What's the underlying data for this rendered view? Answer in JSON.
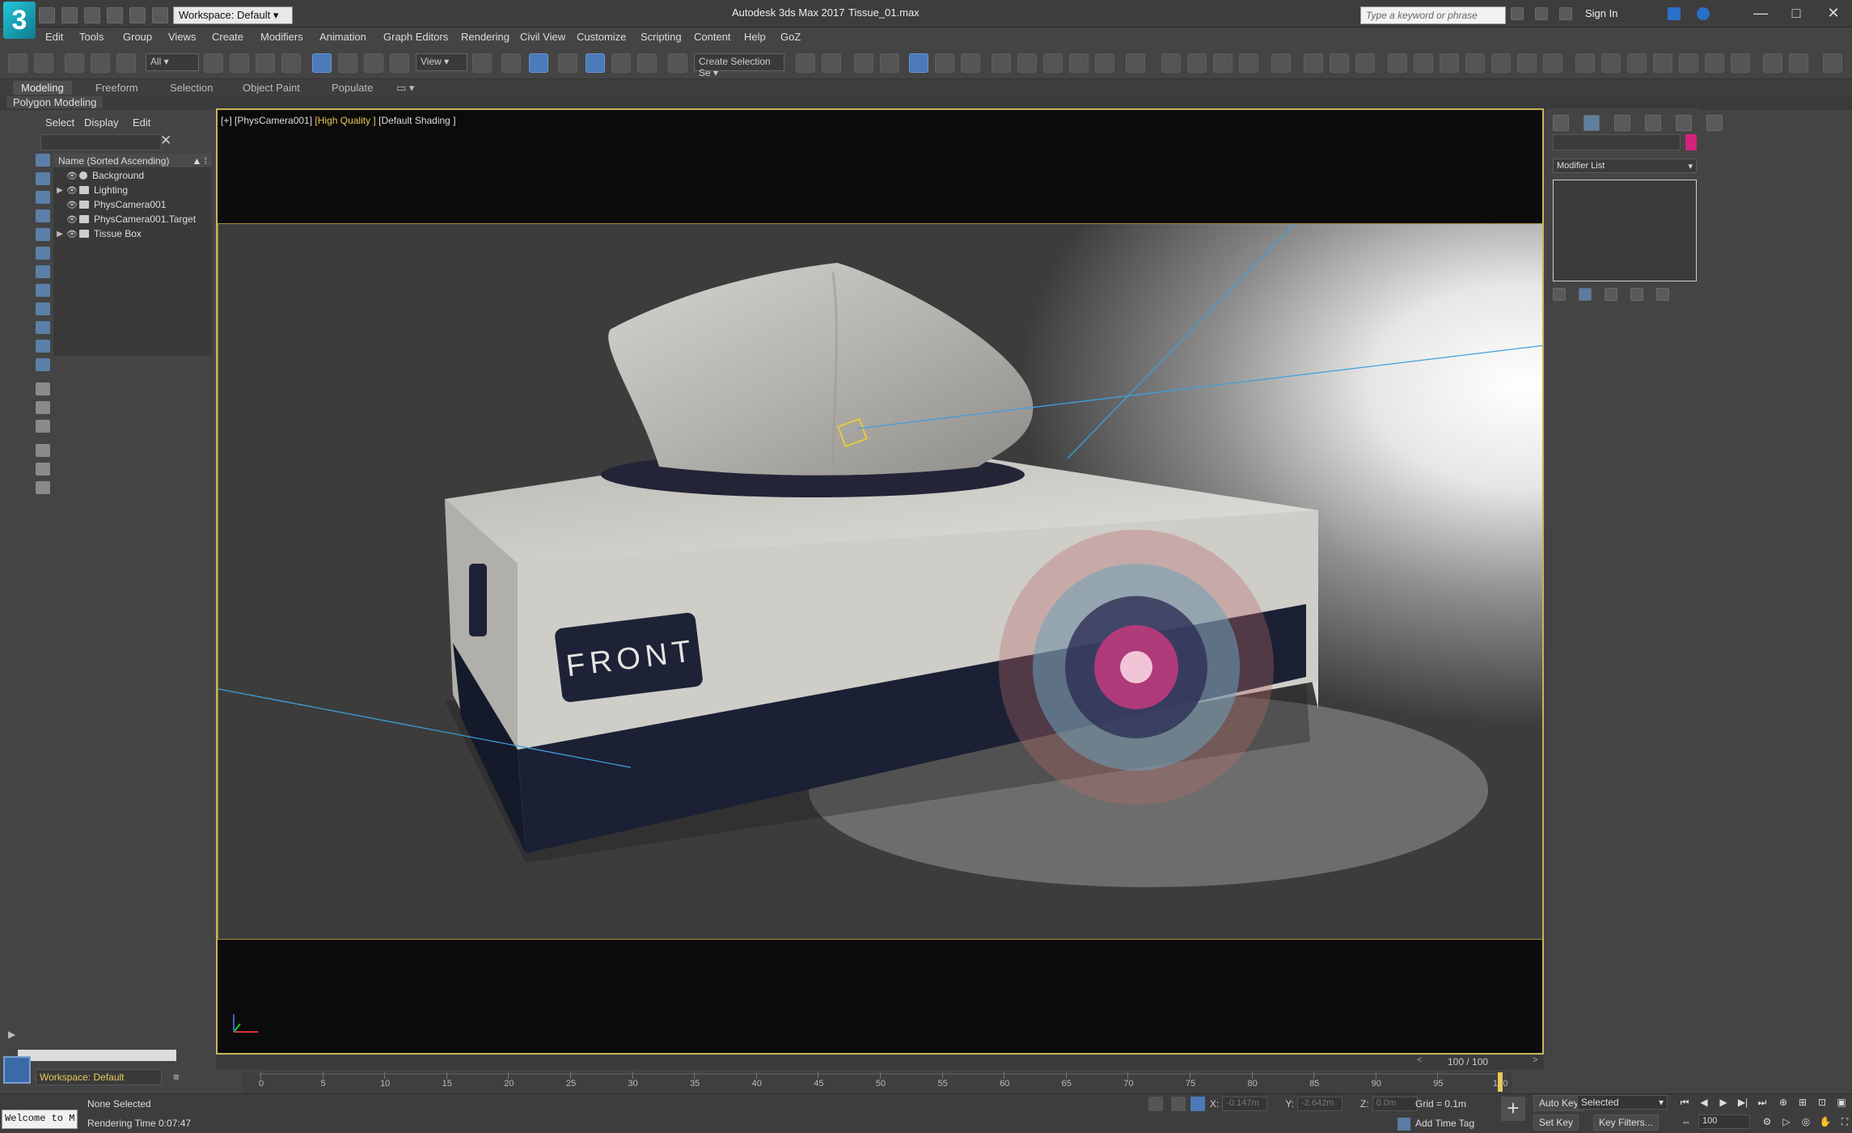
{
  "titlebar": {
    "workspace": "Workspace: Default",
    "app_title": "Autodesk 3ds Max 2017",
    "file_title": "Tissue_01.max",
    "search_placeholder": "Type a keyword or phrase",
    "sign_in": "Sign In"
  },
  "menu": [
    "Edit",
    "Tools",
    "Group",
    "Views",
    "Create",
    "Modifiers",
    "Animation",
    "Graph Editors",
    "Rendering",
    "Civil View",
    "Customize",
    "Scripting",
    "Content",
    "Help",
    "GoZ"
  ],
  "toolbar": {
    "selection_filter": "All",
    "reference_coord": "View",
    "named_selection": "Create Selection Se"
  },
  "ribbon": {
    "tabs": [
      "Modeling",
      "Freeform",
      "Selection",
      "Object Paint",
      "Populate"
    ],
    "active_tab": "Modeling",
    "panel_title": "Polygon Modeling"
  },
  "scene_explorer": {
    "menus": [
      "Select",
      "Display",
      "Edit"
    ],
    "column_header": "Name (Sorted Ascending)",
    "items": [
      {
        "name": "Background",
        "expandable": false,
        "type": "environment"
      },
      {
        "name": "Lighting",
        "expandable": true,
        "type": "group"
      },
      {
        "name": "PhysCamera001",
        "expandable": false,
        "type": "camera"
      },
      {
        "name": "PhysCamera001.Target",
        "expandable": false,
        "type": "camera-target"
      },
      {
        "name": "Tissue Box",
        "expandable": true,
        "type": "group"
      }
    ]
  },
  "viewport": {
    "label_prefix": "[+] [PhysCamera001]",
    "quality": "[High Quality ]",
    "shading": "[Default Shading ]",
    "box_text": "FRONT"
  },
  "command_panel": {
    "modifier_list": "Modifier List",
    "object_color": "#d4237a"
  },
  "timeline": {
    "frame": "100 / 100",
    "ticks": [
      "0",
      "5",
      "10",
      "15",
      "20",
      "25",
      "30",
      "35",
      "40",
      "45",
      "50",
      "55",
      "60",
      "65",
      "70",
      "75",
      "80",
      "85",
      "90",
      "95",
      "100"
    ]
  },
  "status": {
    "workspace": "Workspace: Default",
    "listener": "Welcome to M",
    "selection": "None Selected",
    "render_time": "Rendering Time  0:07:47",
    "x_label": "X:",
    "x_value": "-0.147m",
    "y_label": "Y:",
    "y_value": "-2.642m",
    "z_label": "Z:",
    "z_value": "0.0m",
    "grid": "Grid = 0.1m",
    "add_time_tag": "Add Time Tag",
    "auto_key": "Auto Key",
    "set_key": "Set Key",
    "key_mode": "Selected",
    "key_filters": "Key Filters...",
    "current_frame": "100"
  }
}
